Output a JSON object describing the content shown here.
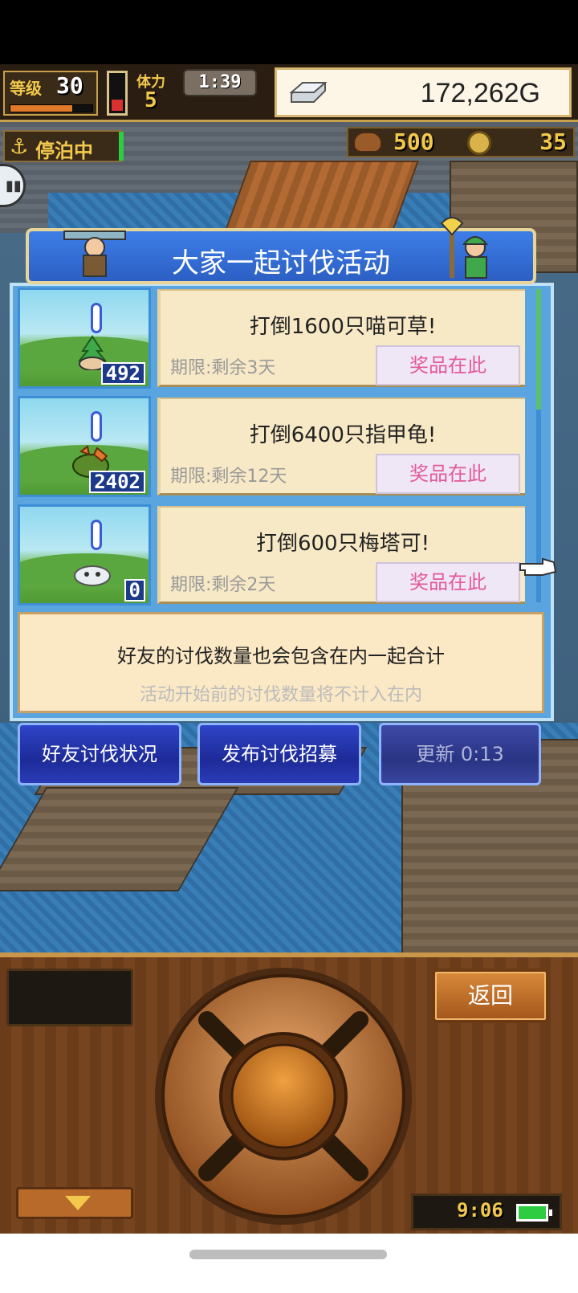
{
  "hud": {
    "level_label": "等级",
    "level_value": "30",
    "level_progress": 0.75,
    "stamina_label": "体力",
    "stamina_value": "5",
    "timer": "1:39",
    "gold": "172,262G",
    "dock_status": "停泊中",
    "food": "500",
    "coins": "35"
  },
  "event": {
    "title": "大家一起讨伐活动",
    "items": [
      {
        "title": "打倒1600只喵可草!",
        "deadline": "期限:剩余3天",
        "prize": "奖品在此",
        "count": "492",
        "monster": "plant-monster"
      },
      {
        "title": "打倒6400只指甲龟!",
        "deadline": "期限:剩余12天",
        "prize": "奖品在此",
        "count": "2402",
        "monster": "turtle-monster"
      },
      {
        "title": "打倒600只梅塔可!",
        "deadline": "期限:剩余2天",
        "prize": "奖品在此",
        "count": "0",
        "monster": "metal-slime-monster"
      }
    ],
    "info_main": "好友的讨伐数量也会包含在内一起合计",
    "info_sub": "活动开始前的讨伐数量将不计入在内"
  },
  "actions": {
    "friends_status": "好友讨伐状况",
    "post_recruit": "发布讨伐招募",
    "refresh": "更新 0:13"
  },
  "controls": {
    "back": "返回",
    "clock": "9:06"
  },
  "colors": {
    "dialog_blue": "#3d7ee6",
    "card_bg": "#f8e9c6",
    "prize_text": "#e25a9a",
    "button_blue": "#1d2a98",
    "panel_wood": "#6a3c1a"
  }
}
